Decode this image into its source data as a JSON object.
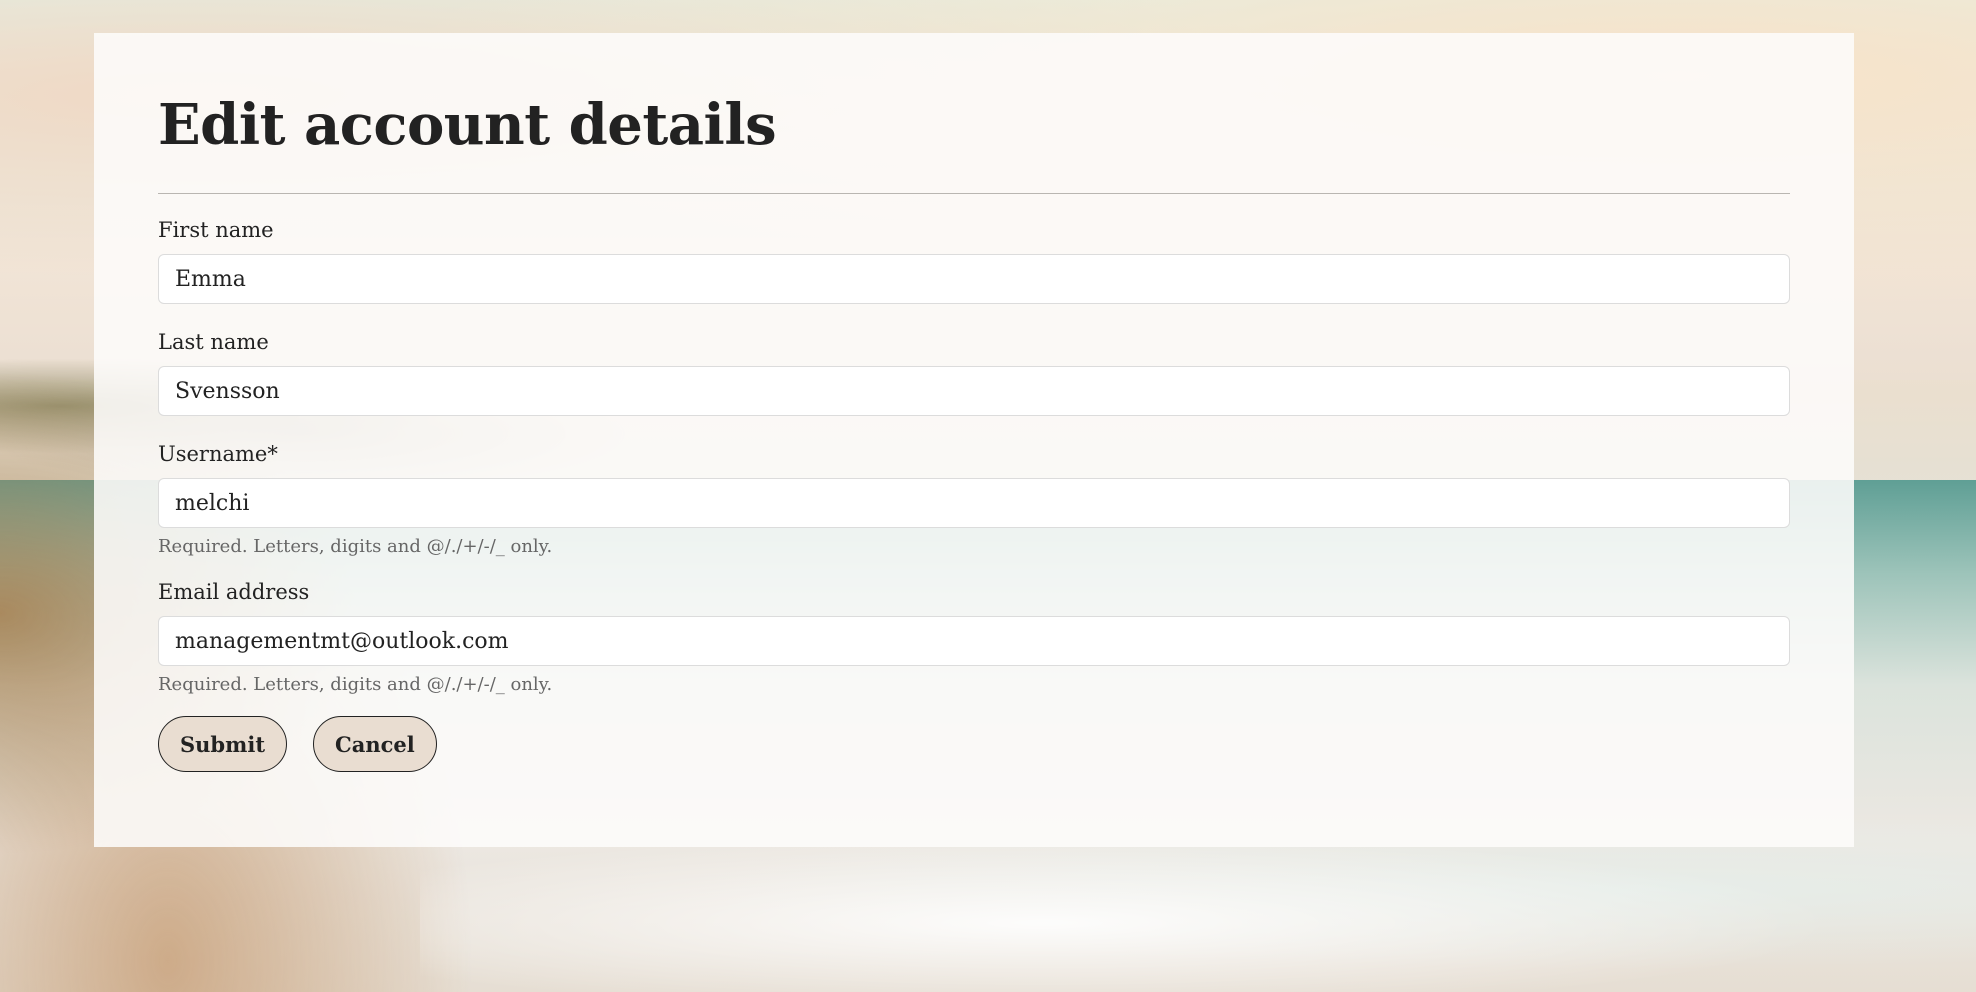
{
  "page": {
    "title": "Edit account details"
  },
  "form": {
    "first_name": {
      "label": "First name",
      "value": "Emma"
    },
    "last_name": {
      "label": "Last name",
      "value": "Svensson"
    },
    "username": {
      "label": "Username*",
      "value": "melchi",
      "help": "Required. Letters, digits and @/./+/-/_ only."
    },
    "email": {
      "label": "Email address",
      "value": "managementmt@outlook.com",
      "help": "Required. Letters, digits and @/./+/-/_ only."
    }
  },
  "actions": {
    "submit_label": "Submit",
    "cancel_label": "Cancel"
  },
  "colors": {
    "button_bg": "#e9ddd1",
    "button_border": "#222222",
    "text": "#222222",
    "help_text": "#666666",
    "card_bg": "#fdfcfa"
  }
}
